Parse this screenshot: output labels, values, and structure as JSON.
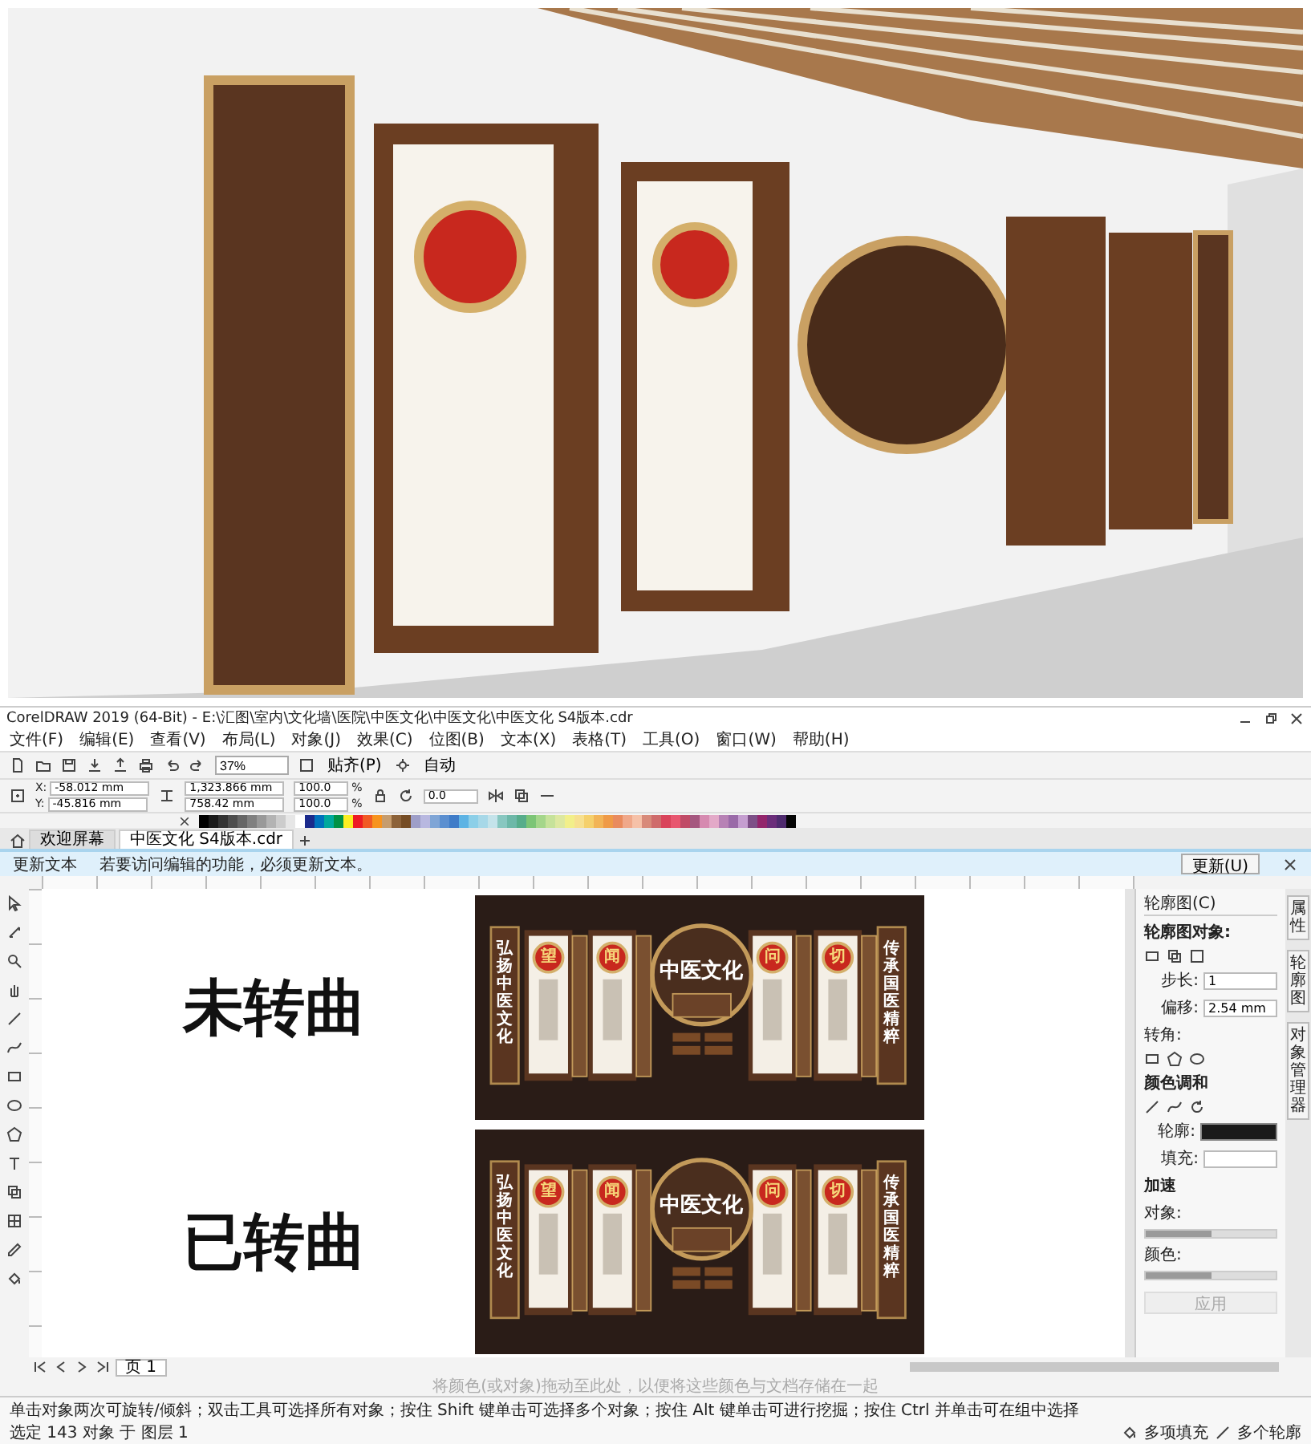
{
  "hero_image": {
    "kind": "picture"
  },
  "window": {
    "title": "CorelDRAW 2019 (64-Bit) - E:\\汇图\\室内\\文化墙\\医院\\中医文化\\中医文化\\中医文化  S4版本.cdr"
  },
  "menu": [
    "文件(F)",
    "编辑(E)",
    "查看(V)",
    "布局(L)",
    "对象(J)",
    "效果(C)",
    "位图(B)",
    "文本(X)",
    "表格(T)",
    "工具(O)",
    "窗口(W)",
    "帮助(H)"
  ],
  "toolbar": {
    "zoom": "37%",
    "snap": "贴齐(P)",
    "mode": "自动"
  },
  "property_bar": {
    "x_label": "X:",
    "x": "-58.012 mm",
    "y_label": "Y:",
    "y": "-45.816 mm",
    "width": "1,323.866 mm",
    "height": "758.42 mm",
    "scale": [
      {
        "value": "100.0",
        "unit": "%"
      },
      {
        "value": "100.0",
        "unit": "%"
      }
    ],
    "rotation": "0.0"
  },
  "palette": [
    {
      "color": "#000000"
    },
    {
      "color": "#1a1a1a"
    },
    {
      "color": "#333333"
    },
    {
      "color": "#4d4d4d"
    },
    {
      "color": "#666666"
    },
    {
      "color": "#808080"
    },
    {
      "color": "#999999"
    },
    {
      "color": "#b3b3b3"
    },
    {
      "color": "#cccccc"
    },
    {
      "color": "#e6e6e6"
    },
    {
      "color": "#ffffff"
    },
    {
      "color": "#1b2a8c"
    },
    {
      "color": "#0071bc"
    },
    {
      "color": "#00a99d"
    },
    {
      "color": "#009245"
    },
    {
      "color": "#fcee21"
    },
    {
      "color": "#ed1c24"
    },
    {
      "color": "#f15a24"
    },
    {
      "color": "#f7931e"
    },
    {
      "color": "#c69c6d"
    },
    {
      "color": "#8c6239"
    },
    {
      "color": "#754c24"
    },
    {
      "color": "#9e9ec8"
    },
    {
      "color": "#b8b8e0"
    },
    {
      "color": "#7fa5d6"
    },
    {
      "color": "#5b8fd0"
    },
    {
      "color": "#3f7cc8"
    },
    {
      "color": "#5db3e4"
    },
    {
      "color": "#8ccfe8"
    },
    {
      "color": "#a7d8e8"
    },
    {
      "color": "#c4e3ea"
    },
    {
      "color": "#88c7c0"
    },
    {
      "color": "#6db8a8"
    },
    {
      "color": "#57ad8b"
    },
    {
      "color": "#7cc576"
    },
    {
      "color": "#a4d68a"
    },
    {
      "color": "#c6e29a"
    },
    {
      "color": "#dde8a0"
    },
    {
      "color": "#f2ef8a"
    },
    {
      "color": "#f7e08f"
    },
    {
      "color": "#f5d06c"
    },
    {
      "color": "#f2b457"
    },
    {
      "color": "#ef9a47"
    },
    {
      "color": "#e98b5e"
    },
    {
      "color": "#f0a88a"
    },
    {
      "color": "#f6c1a8"
    },
    {
      "color": "#d88a7a"
    },
    {
      "color": "#cf6b6b"
    },
    {
      "color": "#d9435a"
    },
    {
      "color": "#e8566f"
    },
    {
      "color": "#c04a66"
    },
    {
      "color": "#a5577f"
    },
    {
      "color": "#d68ab0"
    },
    {
      "color": "#e3a9c8"
    },
    {
      "color": "#b781b5"
    },
    {
      "color": "#9a6aa8"
    },
    {
      "color": "#c59ed0"
    },
    {
      "color": "#7d4f87"
    },
    {
      "color": "#93256c"
    },
    {
      "color": "#6b2d7a"
    },
    {
      "color": "#4e2a6e"
    },
    {
      "color": "#050505"
    }
  ],
  "doc_tabs": [
    {
      "label": "欢迎屏幕",
      "selected": false
    },
    {
      "label": "中医文化  S4版本.cdr",
      "selected": true
    }
  ],
  "notice": {
    "title": "更新文本",
    "message": "若要访问编辑的功能，必须更新文本。",
    "button": "更新(U)"
  },
  "canvas": {
    "boards": [
      {
        "caption": "未转曲",
        "left_title": "弘扬中医文化",
        "right_title": "传承国医精粹",
        "center_title": "中医文化",
        "seals": [
          "望",
          "闻",
          "问",
          "切"
        ]
      },
      {
        "caption": "已转曲",
        "left_title": "弘扬中医文化",
        "right_title": "传承国医精粹",
        "center_title": "中医文化",
        "seals": [
          "望",
          "闻",
          "问",
          "切"
        ]
      }
    ]
  },
  "docker": {
    "title": "轮廓图(C)",
    "object_label": "轮廓图对象:",
    "steps_label": "步长:",
    "steps": "1",
    "offset_label": "偏移:",
    "offset": "2.54 mm",
    "corner_label": "转角:",
    "color_label": "颜色调和",
    "outline_label": "轮廓:",
    "fill_label": "填充:",
    "accel_label": "加速",
    "sliders": [
      {
        "label": "对象:",
        "level": 0.5
      },
      {
        "label": "颜色:",
        "level": 0.5
      }
    ],
    "apply": "应用",
    "apply_disabled": true
  },
  "side_tabs": [
    "属性",
    "轮廓图",
    "对象管理器"
  ],
  "page_tabs": [
    {
      "label": "页 1",
      "selected": true
    }
  ],
  "palette_hint": "将颜色(或对象)拖动至此处，以便将这些颜色与文档存储在一起",
  "status_bar": {
    "hint": "单击对象两次可旋转/倾斜；双击工具可选择所有对象；按住 Shift 键单击可选择多个对象；按住 Alt 键单击可进行挖掘；按住 Ctrl 并单击可在组中选择",
    "selection": "选定 143 对象 于 图层 1",
    "fill": "多项填充",
    "outline": "多个轮廓"
  }
}
